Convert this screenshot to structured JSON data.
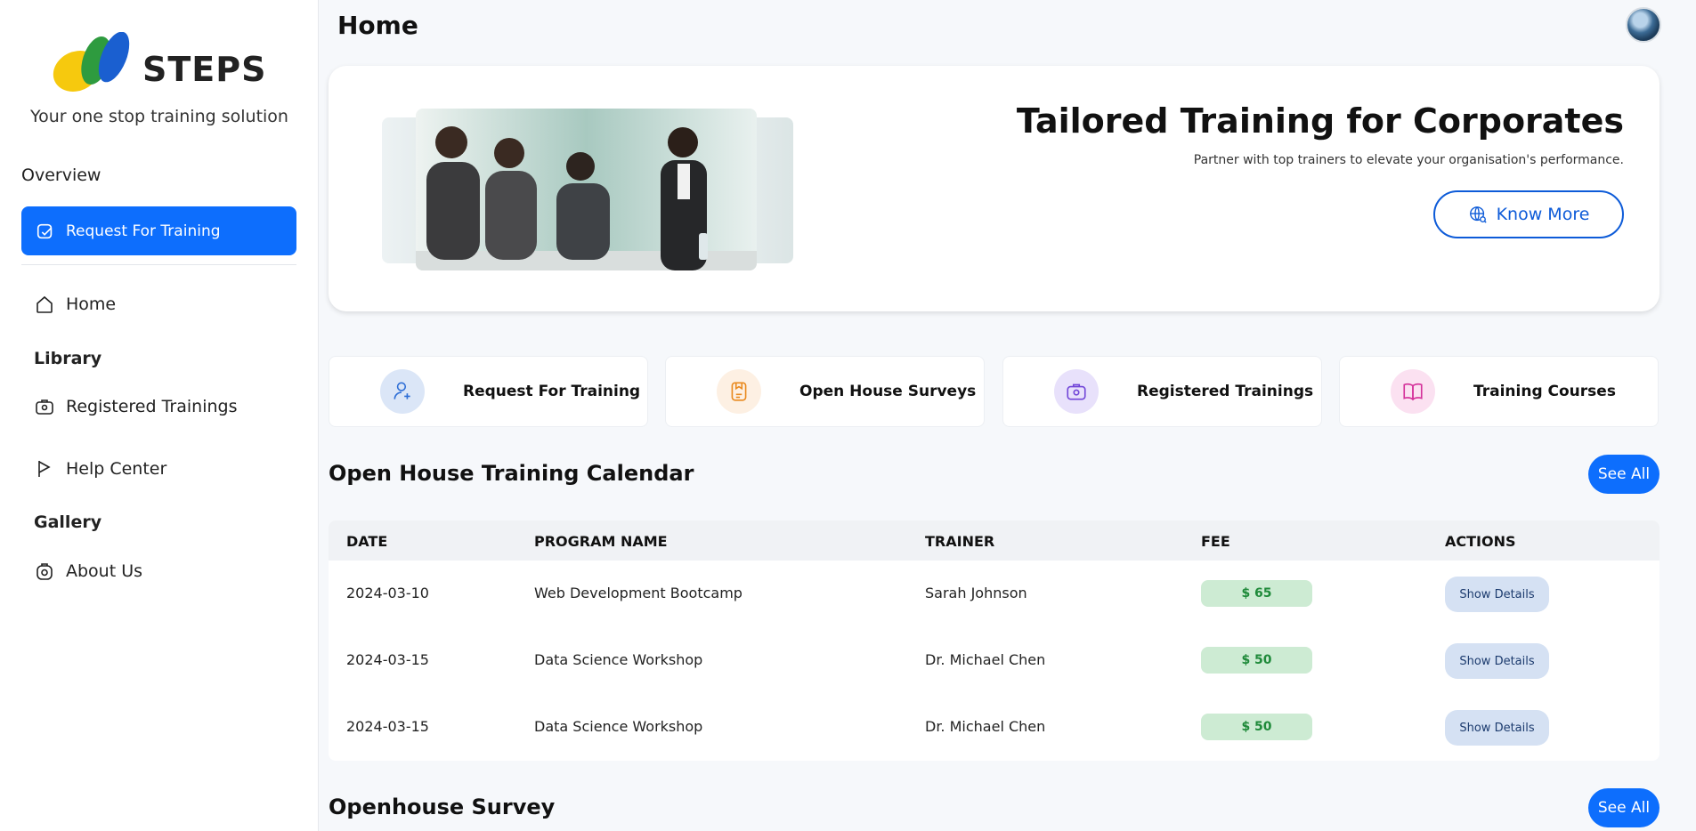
{
  "brand": {
    "name": "STEPS",
    "tagline": "Your one stop training solution"
  },
  "sidebar": {
    "overview_label": "Overview",
    "primary_action": "Request For Training",
    "home_label": "Home",
    "library_heading": "Library",
    "registered_label": "Registered Trainings",
    "help_label": "Help Center",
    "gallery_heading": "Gallery",
    "about_label": "About Us"
  },
  "header": {
    "title": "Home"
  },
  "hero": {
    "title": "Tailored Training for Corporates",
    "subtitle": "Partner with top trainers to elevate your organisation's performance.",
    "cta": "Know More"
  },
  "quick_links": [
    {
      "label": "Request For Training",
      "icon": "user-add-icon",
      "color": "#dbe6f7"
    },
    {
      "label": "Open House Surveys",
      "icon": "survey-icon",
      "color": "#fdf0e3"
    },
    {
      "label": "Registered Trainings",
      "icon": "briefcase-icon",
      "color": "#e8e1fb"
    },
    {
      "label": "Training Courses",
      "icon": "book-icon",
      "color": "#fbe1f1"
    }
  ],
  "calendar": {
    "title": "Open House Training Calendar",
    "see_all": "See All",
    "columns": [
      "DATE",
      "PROGRAM NAME",
      "TRAINER",
      "FEE",
      "ACTIONS"
    ],
    "rows": [
      {
        "date": "2024-03-10",
        "program": "Web Development Bootcamp",
        "trainer": "Sarah Johnson",
        "fee": "$ 65",
        "action": "Show Details"
      },
      {
        "date": "2024-03-15",
        "program": "Data Science Workshop",
        "trainer": "Dr. Michael Chen",
        "fee": "$ 50",
        "action": "Show Details"
      },
      {
        "date": "2024-03-15",
        "program": "Data Science Workshop",
        "trainer": "Dr. Michael Chen",
        "fee": "$ 50",
        "action": "Show Details"
      }
    ]
  },
  "survey": {
    "title": "Openhouse Survey",
    "see_all": "See All"
  },
  "colors": {
    "accent": "#0d6efd",
    "fee_bg": "#cdebd3",
    "fee_text": "#1f8a3a"
  }
}
